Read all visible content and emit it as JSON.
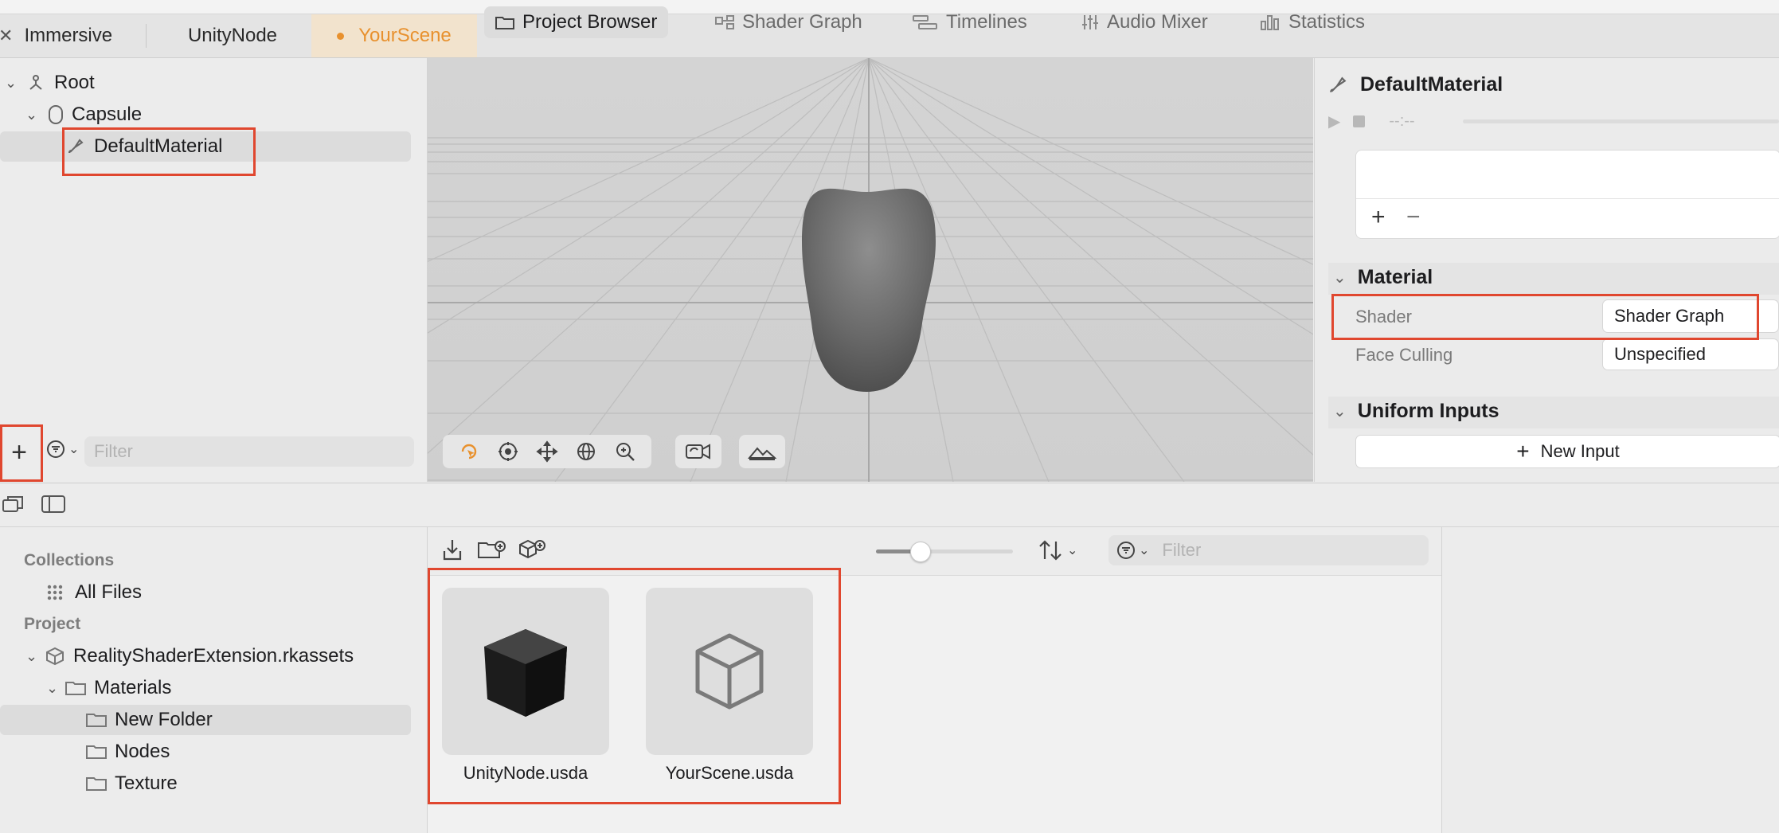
{
  "tabs": [
    {
      "label": "Immersive",
      "close_icon": "close-icon"
    },
    {
      "label": "UnityNode"
    },
    {
      "label": "YourScene",
      "modified": true
    }
  ],
  "outline": {
    "items": [
      {
        "label": "Root",
        "icon": "root-node-icon"
      },
      {
        "label": "Capsule",
        "icon": "capsule-icon"
      },
      {
        "label": "DefaultMaterial",
        "icon": "material-brush-icon"
      }
    ],
    "filter_placeholder": "Filter"
  },
  "inspector": {
    "title": "DefaultMaterial",
    "timecode": "--:--",
    "material_section": "Material",
    "shader_label": "Shader",
    "shader_value": "Shader Graph",
    "face_culling_label": "Face Culling",
    "face_culling_value": "Unspecified",
    "uniform_section": "Uniform Inputs",
    "new_input_label": "New Input"
  },
  "bottom_tabs": [
    {
      "label": "Project Browser",
      "active": true
    },
    {
      "label": "Shader Graph"
    },
    {
      "label": "Timelines"
    },
    {
      "label": "Audio Mixer"
    },
    {
      "label": "Statistics"
    }
  ],
  "project_sidebar": {
    "collections_header": "Collections",
    "all_files": "All Files",
    "project_header": "Project",
    "package": "RealityShaderExtension.rkassets",
    "folders": [
      "Materials",
      "New Folder",
      "Nodes",
      "Texture"
    ]
  },
  "browser": {
    "filter_placeholder": "Filter",
    "files": [
      {
        "name": "UnityNode.usda"
      },
      {
        "name": "YourScene.usda"
      }
    ],
    "thumbnail_size": 0.3
  },
  "colors": {
    "accent": "#e8912e",
    "highlight": "#e0472f"
  }
}
